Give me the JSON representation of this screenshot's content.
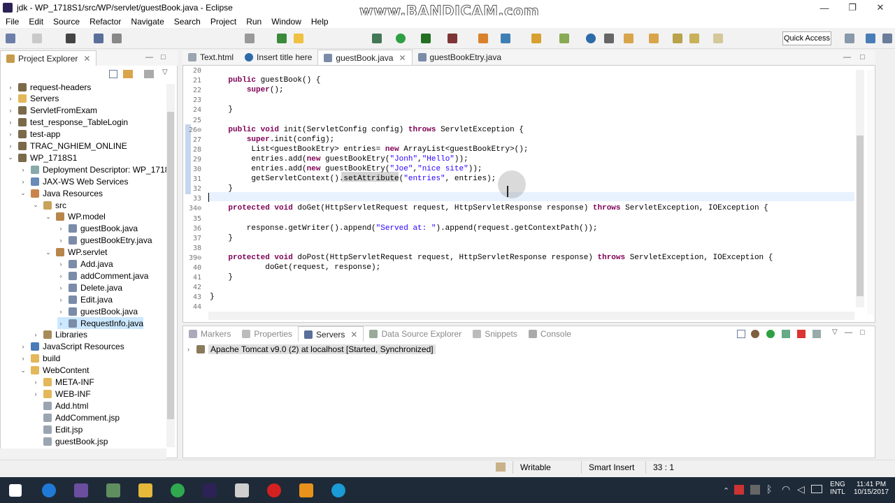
{
  "window": {
    "title": "jdk - WP_1718S1/src/WP/servlet/guestBook.java - Eclipse",
    "watermark": "www.BANDICAM.com",
    "minimize": "—",
    "maximize": "❐",
    "close": "✕"
  },
  "menu": [
    "File",
    "Edit",
    "Source",
    "Refactor",
    "Navigate",
    "Search",
    "Project",
    "Run",
    "Window",
    "Help"
  ],
  "toolbar": {
    "quick_access": "Quick Access"
  },
  "project_explorer": {
    "title": "Project Explorer",
    "items": [
      {
        "label": "request-headers",
        "depth": 0,
        "arrow": "›",
        "icon": "project-icon"
      },
      {
        "label": "Servers",
        "depth": 0,
        "arrow": "›",
        "icon": "folder-icon"
      },
      {
        "label": "ServletFromExam",
        "depth": 0,
        "arrow": "›",
        "icon": "project-icon"
      },
      {
        "label": "test_response_TableLogin",
        "depth": 0,
        "arrow": "›",
        "icon": "project-icon"
      },
      {
        "label": "test-app",
        "depth": 0,
        "arrow": "›",
        "icon": "project-icon"
      },
      {
        "label": "TRAC_NGHIEM_ONLINE",
        "depth": 0,
        "arrow": "›",
        "icon": "project-icon"
      },
      {
        "label": "WP_1718S1",
        "depth": 0,
        "arrow": "⌄",
        "icon": "project-icon"
      },
      {
        "label": "Deployment Descriptor: WP_1718S1",
        "depth": 1,
        "arrow": "›",
        "icon": "descriptor-icon"
      },
      {
        "label": "JAX-WS Web Services",
        "depth": 1,
        "arrow": "›",
        "icon": "webservice-icon"
      },
      {
        "label": "Java Resources",
        "depth": 1,
        "arrow": "⌄",
        "icon": "java-resources-icon"
      },
      {
        "label": "src",
        "depth": 2,
        "arrow": "⌄",
        "icon": "source-folder-icon"
      },
      {
        "label": "WP.model",
        "depth": 3,
        "arrow": "⌄",
        "icon": "package-icon"
      },
      {
        "label": "guestBook.java",
        "depth": 4,
        "arrow": "›",
        "icon": "java-file-icon"
      },
      {
        "label": "guestBookEtry.java",
        "depth": 4,
        "arrow": "›",
        "icon": "java-file-icon"
      },
      {
        "label": "WP.servlet",
        "depth": 3,
        "arrow": "⌄",
        "icon": "package-icon"
      },
      {
        "label": "Add.java",
        "depth": 4,
        "arrow": "›",
        "icon": "java-file-icon"
      },
      {
        "label": "addComment.java",
        "depth": 4,
        "arrow": "›",
        "icon": "java-file-icon"
      },
      {
        "label": "Delete.java",
        "depth": 4,
        "arrow": "›",
        "icon": "java-file-icon"
      },
      {
        "label": "Edit.java",
        "depth": 4,
        "arrow": "›",
        "icon": "java-file-icon"
      },
      {
        "label": "guestBook.java",
        "depth": 4,
        "arrow": "›",
        "icon": "java-file-icon"
      },
      {
        "label": "RequestInfo.java",
        "depth": 4,
        "arrow": "›",
        "icon": "java-file-icon",
        "selected": true
      },
      {
        "label": "Libraries",
        "depth": 2,
        "arrow": "›",
        "icon": "library-icon"
      },
      {
        "label": "JavaScript Resources",
        "depth": 1,
        "arrow": "›",
        "icon": "js-resources-icon"
      },
      {
        "label": "build",
        "depth": 1,
        "arrow": "›",
        "icon": "folder-icon"
      },
      {
        "label": "WebContent",
        "depth": 1,
        "arrow": "⌄",
        "icon": "folder-icon"
      },
      {
        "label": "META-INF",
        "depth": 2,
        "arrow": "›",
        "icon": "folder-icon"
      },
      {
        "label": "WEB-INF",
        "depth": 2,
        "arrow": "›",
        "icon": "folder-icon"
      },
      {
        "label": "Add.html",
        "depth": 2,
        "arrow": "",
        "icon": "html-file-icon"
      },
      {
        "label": "AddComment.jsp",
        "depth": 2,
        "arrow": "",
        "icon": "jsp-file-icon"
      },
      {
        "label": "Edit.jsp",
        "depth": 2,
        "arrow": "",
        "icon": "jsp-file-icon"
      },
      {
        "label": "guestBook.jsp",
        "depth": 2,
        "arrow": "",
        "icon": "jsp-file-icon"
      }
    ]
  },
  "editor": {
    "tabs": [
      {
        "label": "Text.html",
        "icon": "html-file-icon",
        "active": false
      },
      {
        "label": "Insert title here",
        "icon": "browser-icon",
        "active": false
      },
      {
        "label": "guestBook.java",
        "icon": "java-file-icon",
        "active": true
      },
      {
        "label": "guestBookEtry.java",
        "icon": "java-file-icon",
        "active": false
      }
    ],
    "lines": [
      {
        "n": "20",
        "html": ""
      },
      {
        "n": "21",
        "html": "    <span class='kw'>public</span> guestBook() {"
      },
      {
        "n": "22",
        "html": "        <span class='kw'>super</span>();"
      },
      {
        "n": "23",
        "html": ""
      },
      {
        "n": "24",
        "html": "    }"
      },
      {
        "n": "25",
        "html": ""
      },
      {
        "n": "26⊖",
        "html": "    <span class='kw'>public void</span> init(ServletConfig config) <span class='kw'>throws</span> ServletException {"
      },
      {
        "n": "27",
        "html": "        <span class='kw'>super</span>.init(config);"
      },
      {
        "n": "28",
        "html": "         List&lt;guestBookEtry&gt; entries= <span class='kw'>new</span> ArrayList&lt;guestBookEtry&gt;();"
      },
      {
        "n": "29",
        "html": "         entries.add(<span class='kw'>new</span> guestBookEtry(<span class='str'>\"Jonh\"</span>,<span class='str'>\"Hello\"</span>));"
      },
      {
        "n": "30",
        "html": "         entries.add(<span class='kw'>new</span> guestBookEtry(<span class='str'>\"Joe\"</span>,<span class='str'>\"nice site\"</span>));"
      },
      {
        "n": "31",
        "html": "         getServletContext().setAttribute(<span class='str'>\"entries\"</span>, entries);"
      },
      {
        "n": "32",
        "html": "    }"
      },
      {
        "n": "33",
        "html": ""
      },
      {
        "n": "34⊖",
        "html": "    <span class='kw'>protected void</span> doGet(HttpServletRequest request, HttpServletResponse response) <span class='kw'>throws</span> ServletException, IOException {"
      },
      {
        "n": "35",
        "html": ""
      },
      {
        "n": "36",
        "html": "        response.getWriter().append(<span class='str'>\"Served at: \"</span>).append(request.getContextPath());"
      },
      {
        "n": "37",
        "html": "    }"
      },
      {
        "n": "38",
        "html": ""
      },
      {
        "n": "39⊖",
        "html": "    <span class='kw'>protected void</span> doPost(HttpServletRequest request, HttpServletResponse response) <span class='kw'>throws</span> ServletException, IOException {"
      },
      {
        "n": "40",
        "html": "            doGet(request, response);"
      },
      {
        "n": "41",
        "html": "    }"
      },
      {
        "n": "42",
        "html": ""
      },
      {
        "n": "43",
        "html": "}"
      },
      {
        "n": "44",
        "html": ""
      }
    ]
  },
  "bottom_panel": {
    "tabs": [
      "Markers",
      "Properties",
      "Servers",
      "Data Source Explorer",
      "Snippets",
      "Console"
    ],
    "active_tab": "Servers",
    "server_entry": "Apache Tomcat v9.0 (2) at localhost  [Started, Synchronized]"
  },
  "statusbar": {
    "writable": "Writable",
    "insert_mode": "Smart Insert",
    "position": "33 : 1"
  },
  "taskbar": {
    "lang": "ENG",
    "layout": "INTL",
    "time": "11:41 PM",
    "date": "10/15/2017"
  },
  "colors": {
    "keyword": "#7f0055",
    "string": "#2a00ff",
    "selection": "#cce8ff",
    "taskbar": "#1e2a38"
  }
}
